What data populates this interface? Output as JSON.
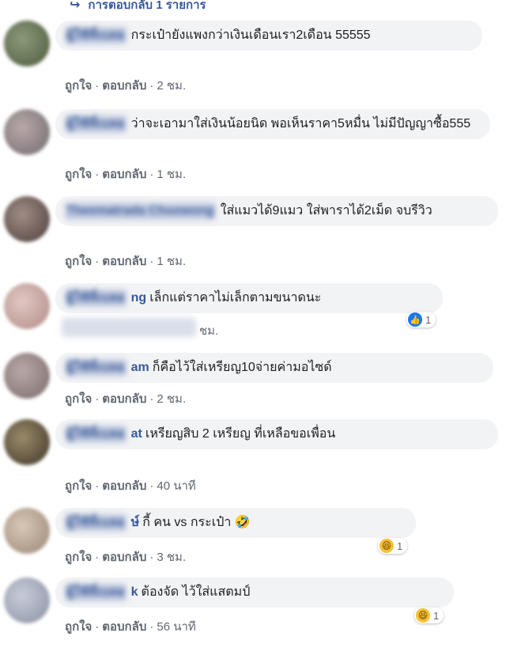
{
  "top_reply": {
    "label": "การตอบกลับ 1 รายการ"
  },
  "actions": {
    "like": "ถูกใจ",
    "reply": "ตอบกลับ",
    "dot": "·"
  },
  "comments": [
    {
      "author": "ผู้ใช้ที่เบลอ",
      "author_tail": "",
      "text": "กระเป๋ายังแพงกว่าเงินเดือนเรา2เดือน 55555",
      "time": "2 ชม."
    },
    {
      "author": "ผู้ใช้ที่เบลอ",
      "author_tail": "",
      "text": "ว่าจะเอามาใส่เงินน้อยนิด พอเห็นราคา5หมื่น ไม่มีปัญญาซื้อ555",
      "time": "1 ชม."
    },
    {
      "author": "Theematrada Choowong",
      "author_tail": "",
      "text": "ใส่แมวได้9แมว ใส่พาราได้2เม็ด จบรีวิว",
      "time": "1 ชม."
    },
    {
      "author": "ผู้ใช้ที่เบลอ",
      "author_tail": "ng",
      "text": "เล็กแต่ราคาไม่เล็กตามขนาดนะ",
      "time": "ชม.",
      "reaction": {
        "type": "like",
        "count": "1"
      }
    },
    {
      "author": "ผู้ใช้ที่เบลอ",
      "author_tail": "am",
      "text": "ก็คือไว้ใส่เหรียญ10จ่ายค่ามอไซด์",
      "time": "2 ชม."
    },
    {
      "author": "ผู้ใช้ที่เบลอ",
      "author_tail": "at",
      "text": "เหรียญสิบ 2 เหรียญ ที่เหลือขอเพื่อน",
      "time": "40 นาที"
    },
    {
      "author": "ผู้ใช้ที่เบลอ",
      "author_tail": "ษ์",
      "text": "กี้ คน vs กระเป๋า 🤣",
      "time": "3 ชม.",
      "reaction": {
        "type": "haha",
        "count": "1"
      }
    },
    {
      "author": "ผู้ใช้ที่เบลอ",
      "author_tail": "k",
      "text": "ต้องจัด ไว้ใส่แสตมป์",
      "time": "56 นาที",
      "reaction": {
        "type": "haha",
        "count": "1"
      }
    }
  ],
  "colors": {
    "link": "#385898",
    "bubble": "#f2f3f5",
    "meta": "#606770",
    "like": "#1877f2",
    "haha": "#f7c034"
  }
}
